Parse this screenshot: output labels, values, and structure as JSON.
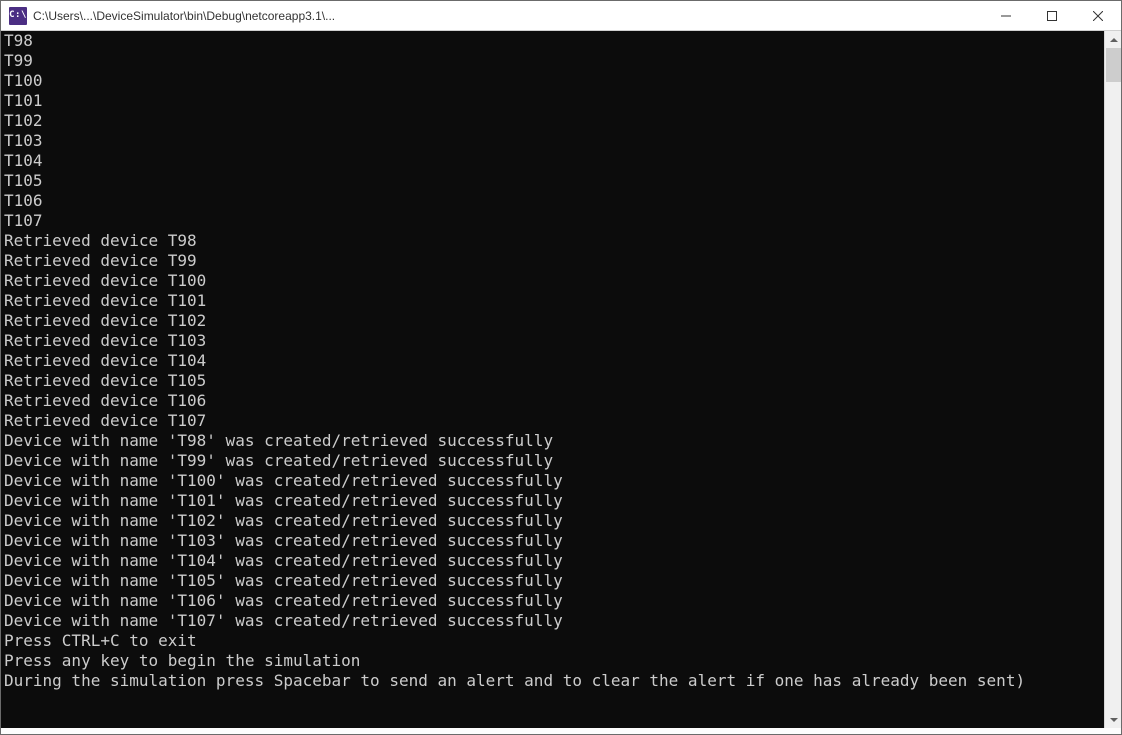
{
  "titlebar": {
    "icon_text": "C:\\",
    "title": "C:\\Users\\...\\DeviceSimulator\\bin\\Debug\\netcoreapp3.1\\..."
  },
  "console_lines": [
    "T98",
    "T99",
    "T100",
    "T101",
    "T102",
    "T103",
    "T104",
    "T105",
    "T106",
    "T107",
    "Retrieved device T98",
    "Retrieved device T99",
    "Retrieved device T100",
    "Retrieved device T101",
    "Retrieved device T102",
    "Retrieved device T103",
    "Retrieved device T104",
    "Retrieved device T105",
    "Retrieved device T106",
    "Retrieved device T107",
    "Device with name 'T98' was created/retrieved successfully",
    "Device with name 'T99' was created/retrieved successfully",
    "Device with name 'T100' was created/retrieved successfully",
    "Device with name 'T101' was created/retrieved successfully",
    "Device with name 'T102' was created/retrieved successfully",
    "Device with name 'T103' was created/retrieved successfully",
    "Device with name 'T104' was created/retrieved successfully",
    "Device with name 'T105' was created/retrieved successfully",
    "Device with name 'T106' was created/retrieved successfully",
    "Device with name 'T107' was created/retrieved successfully",
    "Press CTRL+C to exit",
    "Press any key to begin the simulation",
    "During the simulation press Spacebar to send an alert and to clear the alert if one has already been sent)"
  ]
}
